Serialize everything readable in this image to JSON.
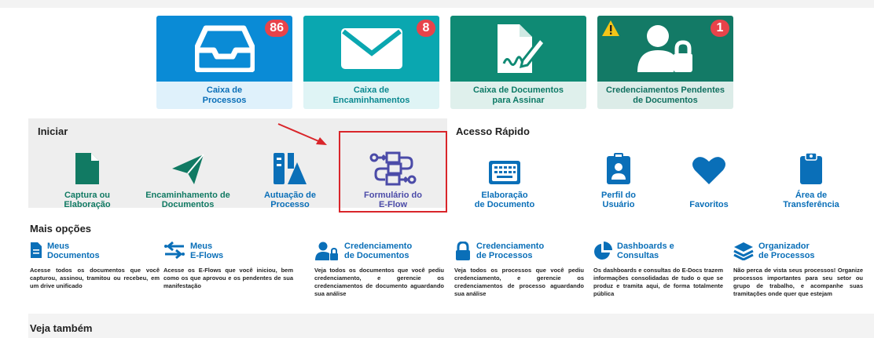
{
  "tiles": [
    {
      "label_line1": "Caixa de",
      "label_line2": "Processos",
      "badge": "86",
      "icon": "inbox-icon",
      "color": "#0a8bd6",
      "footer_color": "#dff1fb",
      "text_color": "#0a6fb8"
    },
    {
      "label_line1": "Caixa de",
      "label_line2": "Encaminhamentos",
      "badge": "8",
      "icon": "envelope-icon",
      "color": "#0aa7b0",
      "footer_color": "#dff4f5",
      "text_color": "#0a8890"
    },
    {
      "label_line1": "Caixa de Documentos",
      "label_line2": "para Assinar",
      "badge": "",
      "icon": "sign-document-icon",
      "color": "#0f8a74",
      "footer_color": "#dff0ec",
      "text_color": "#0d7a66"
    },
    {
      "label_line1": "Credenciamentos Pendentes",
      "label_line2": "de Documentos",
      "badge": "1",
      "icon": "user-lock-icon",
      "color": "#137a66",
      "footer_color": "#dcece8",
      "text_color": "#117060"
    }
  ],
  "iniciar": {
    "title": "Iniciar",
    "items": [
      {
        "line1": "Captura ou",
        "line2": "Elaboração",
        "icon": "document-icon"
      },
      {
        "line1": "Encaminhamento de",
        "line2": "Documentos",
        "icon": "paper-plane-icon"
      },
      {
        "line1": "Autuação de",
        "line2": "Processo",
        "icon": "process-icon"
      },
      {
        "line1": "Formulário do",
        "line2": "E-Flow",
        "icon": "flow-icon"
      }
    ]
  },
  "acesso": {
    "title": "Acesso Rápido",
    "items": [
      {
        "line1": "Elaboração",
        "line2": "de Documento",
        "icon": "keyboard-icon"
      },
      {
        "line1": "Perfil do",
        "line2": "Usuário",
        "icon": "user-badge-icon"
      },
      {
        "line1": "",
        "line2": "Favoritos",
        "icon": "heart-icon"
      },
      {
        "line1": "Área de",
        "line2": "Transferência",
        "icon": "clipboard-icon"
      }
    ]
  },
  "mais": {
    "title": "Mais opções",
    "items": [
      {
        "t1": "Meus",
        "t2": "Documentos",
        "desc": "Acesse todos os documentos que você capturou, assinou, tramitou ou recebeu, em um drive unificado",
        "icon": "file-icon"
      },
      {
        "t1": "Meus",
        "t2": "E-Flows",
        "desc": "Acesse os E-Flows que você iniciou, bem como os que aprovou e os pendentes de sua manifestação",
        "icon": "exchange-icon"
      },
      {
        "t1": "Credenciamento",
        "t2": "de Documentos",
        "desc": "Veja todos os documentos que você pediu credenciamento, e gerencie os credenciamentos de documento aguardando sua análise",
        "icon": "user-lock-icon"
      },
      {
        "t1": "Credenciamento",
        "t2": "de Processos",
        "desc": "Veja todos os processos que você pediu credenciamento, e gerencie os credenciamentos de processo aguardando sua análise",
        "icon": "lock-icon"
      },
      {
        "t1": "Dashboards e",
        "t2": "Consultas",
        "desc": "Os dashboards e consultas do E-Docs trazem informações consolidadas de tudo o que se produz e tramita aqui, de forma totalmente pública",
        "icon": "pie-chart-icon"
      },
      {
        "t1": "Organizador",
        "t2": "de Processos",
        "desc": "Não perca de vista seus processos! Organize processos importantes para seu setor ou grupo de trabalho, e acompanhe suas tramitações onde quer que estejam",
        "icon": "layers-icon"
      }
    ]
  },
  "veja": {
    "title": "Veja também"
  }
}
